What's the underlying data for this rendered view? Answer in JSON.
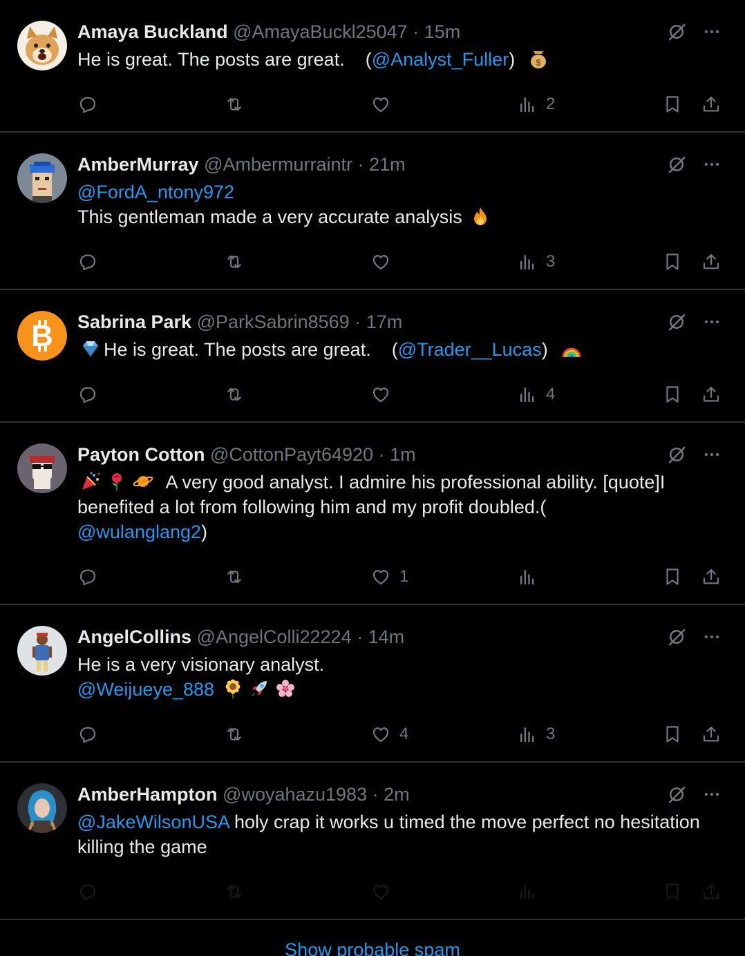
{
  "posts": [
    {
      "name": "Amaya Buckland",
      "handle": "@AmayaBuckl25047",
      "dot": "·",
      "time": "15m",
      "avatar": "doge-avatar",
      "body_lines": [
        [
          {
            "t": "text",
            "v": "He is great. The posts are great.    ("
          },
          {
            "t": "mention",
            "v": "@Analyst_Fuller"
          },
          {
            "t": "text",
            "v": ")  "
          },
          {
            "t": "emoji",
            "v": "money-bag"
          }
        ]
      ],
      "replies": "",
      "reposts": "",
      "likes": "",
      "views": "2"
    },
    {
      "name": "AmberMurray",
      "handle": "@Ambermurraintr",
      "dot": "·",
      "time": "21m",
      "avatar": "pixel-punk-avatar",
      "body_lines": [
        [
          {
            "t": "mention",
            "v": "@FordA_ntony972"
          }
        ],
        [
          {
            "t": "text",
            "v": "This gentleman made a very accurate analysis "
          },
          {
            "t": "emoji",
            "v": "fire"
          }
        ]
      ],
      "replies": "",
      "reposts": "",
      "likes": "",
      "views": "3"
    },
    {
      "name": "Sabrina Park",
      "handle": "@ParkSabrin8569",
      "dot": "·",
      "time": "17m",
      "avatar": "bitcoin-avatar",
      "body_lines": [
        [
          {
            "t": "emoji",
            "v": "gem"
          },
          {
            "t": "text",
            "v": "He is great. The posts are great.    ("
          },
          {
            "t": "mention",
            "v": "@Trader__Lucas"
          },
          {
            "t": "text",
            "v": ")  "
          },
          {
            "t": "emoji",
            "v": "rainbow"
          }
        ]
      ],
      "replies": "",
      "reposts": "",
      "likes": "",
      "views": "4"
    },
    {
      "name": "Payton Cotton",
      "handle": "@CottonPayt64920",
      "dot": "·",
      "time": "1m",
      "avatar": "sunglasses-avatar",
      "body_lines": [
        [
          {
            "t": "emoji",
            "v": "party-popper"
          },
          {
            "t": "emoji",
            "v": "rose"
          },
          {
            "t": "emoji",
            "v": "ringed-planet"
          },
          {
            "t": "text",
            "v": "  A very good analyst. I admire his professional ability. [quote]I"
          }
        ],
        [
          {
            "t": "text",
            "v": "benefited a lot from following him and my profit doubled.("
          }
        ],
        [
          {
            "t": "mention",
            "v": "@wulanglang2"
          },
          {
            "t": "text",
            "v": ")"
          }
        ]
      ],
      "replies": "",
      "reposts": "",
      "likes": "1",
      "views": ""
    },
    {
      "name": "AngelCollins",
      "handle": "@AngelColli22224",
      "dot": "·",
      "time": "14m",
      "avatar": "character-avatar",
      "body_lines": [
        [
          {
            "t": "text",
            "v": "He is a very visionary analyst."
          }
        ],
        [
          {
            "t": "mention",
            "v": "@Weijueye_888"
          },
          {
            "t": "text",
            "v": " "
          },
          {
            "t": "emoji",
            "v": "sunflower"
          },
          {
            "t": "emoji",
            "v": "rocket"
          },
          {
            "t": "emoji",
            "v": "cherry-blossom"
          }
        ]
      ],
      "replies": "",
      "reposts": "",
      "likes": "4",
      "views": "3"
    },
    {
      "name": "AmberHampton",
      "handle": "@woyahazu1983",
      "dot": "·",
      "time": "2m",
      "avatar": "blue-hair-avatar",
      "dim": true,
      "body_lines": [
        [
          {
            "t": "mention",
            "v": "@JakeWilsonUSA"
          },
          {
            "t": "text",
            "v": " holy crap it works u timed the move perfect no hesitation"
          }
        ],
        [
          {
            "t": "text",
            "v": "killing the game"
          }
        ]
      ],
      "replies": "",
      "reposts": "",
      "likes": "",
      "views": ""
    }
  ],
  "spam": {
    "label": "Show probable spam"
  },
  "colors": {
    "accent": "#1d9bf0",
    "muted": "#71767b",
    "divider": "#2f3336"
  }
}
